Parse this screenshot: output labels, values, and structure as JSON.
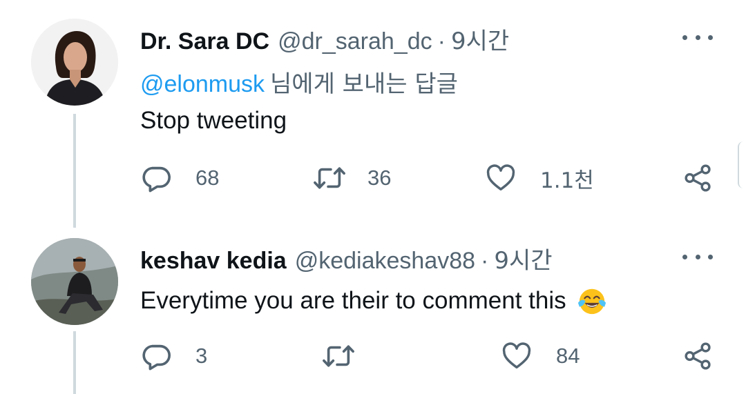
{
  "tweets": [
    {
      "name": "Dr. Sara DC",
      "handle": "@dr_sarah_dc",
      "separator": "·",
      "time": "9시간",
      "reply_to": {
        "mention": "@elonmusk",
        "suffix": "님에게 보내는 답글"
      },
      "text": "Stop tweeting",
      "replies": "68",
      "retweets": "36",
      "likes": "1.1천"
    },
    {
      "name": "keshav kedia",
      "handle": "@kediakeshav88",
      "separator": "·",
      "time": "9시간",
      "text": "Everytime you are their to comment this",
      "emoji": "face-with-tears-of-joy",
      "replies": "3",
      "retweets": "",
      "likes": "84"
    }
  ],
  "colors": {
    "text": "#0f1419",
    "secondary": "#536471",
    "link": "#1d9bf0",
    "line": "#cfd9de"
  }
}
